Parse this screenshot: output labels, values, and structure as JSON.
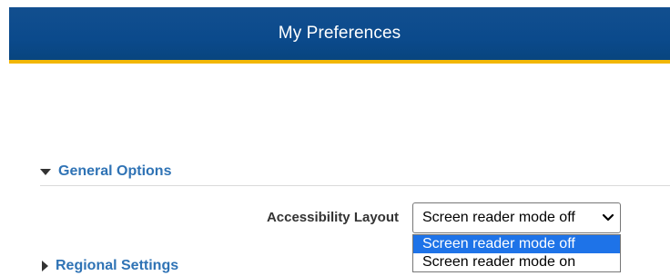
{
  "header": {
    "title": "My Preferences"
  },
  "sections": [
    {
      "label": "General Options",
      "expanded": true
    },
    {
      "label": "Regional Settings",
      "expanded": false
    }
  ],
  "general_options": {
    "accessibility_layout": {
      "label": "Accessibility Layout",
      "value": "Screen reader mode off",
      "options": [
        "Screen reader mode off",
        "Screen reader mode on"
      ],
      "highlighted_option": "Screen reader mode off"
    }
  },
  "colors": {
    "header_bg": "#0b4a8c",
    "header_accent": "#f2b705",
    "section_link": "#2f73b5",
    "option_highlight": "#1e73e8"
  },
  "icons": {
    "expanded": "triangle-down-icon",
    "collapsed": "triangle-right-icon",
    "select": "chevron-down-icon"
  }
}
